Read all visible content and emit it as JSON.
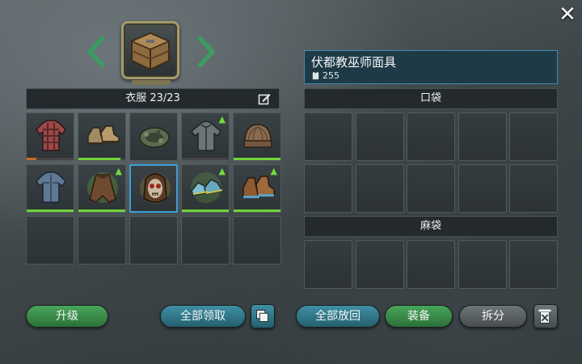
{
  "header": {
    "close_icon": "close-icon",
    "crate_icon": "supply-crate-icon"
  },
  "clothing": {
    "title": "衣服 23/23",
    "edit_icon": "pencil-edit-icon",
    "items": [
      {
        "name": "plaid-jacket",
        "icon": "plaid-shirt-icon",
        "durability": 0.2,
        "upgrade": false
      },
      {
        "name": "leather-boots",
        "icon": "boots-icon",
        "durability": 0.9,
        "upgrade": false
      },
      {
        "name": "camo-bandana",
        "icon": "bandana-icon",
        "durability": 0.0,
        "upgrade": false
      },
      {
        "name": "gray-hoodie",
        "icon": "hoodie-icon",
        "durability": 0.0,
        "upgrade": true
      },
      {
        "name": "knit-beanie",
        "icon": "beanie-icon",
        "durability": 1.0,
        "upgrade": false
      },
      {
        "name": "denim-jacket",
        "icon": "denim-jacket-icon",
        "durability": 1.0,
        "upgrade": false
      },
      {
        "name": "fur-poncho",
        "icon": "poncho-icon",
        "durability": 1.0,
        "upgrade": true
      },
      {
        "name": "voodoo-mask",
        "icon": "skull-mask-icon",
        "durability": 1.0,
        "upgrade": false
      },
      {
        "name": "green-sneakers",
        "icon": "sneakers-icon",
        "durability": 1.0,
        "upgrade": true
      },
      {
        "name": "work-boots",
        "icon": "work-boots-icon",
        "durability": 1.0,
        "upgrade": true
      }
    ]
  },
  "detail": {
    "name": "伏都教巫师面具",
    "value": "255",
    "value_icon": "armor-icon"
  },
  "pocket": {
    "title": "口袋"
  },
  "sack": {
    "title": "麻袋"
  },
  "buttons": {
    "upgrade": "升级",
    "claim_all": "全部领取",
    "stack_icon": "stack-icon",
    "return_all": "全部放回",
    "equip": "装备",
    "dismantle": "拆分",
    "trash_icon": "trash-icon"
  },
  "colors": {
    "accent_green": "#6fd43a",
    "selected_border": "#3aa0d8",
    "detail_bg": "#1f3a47"
  }
}
